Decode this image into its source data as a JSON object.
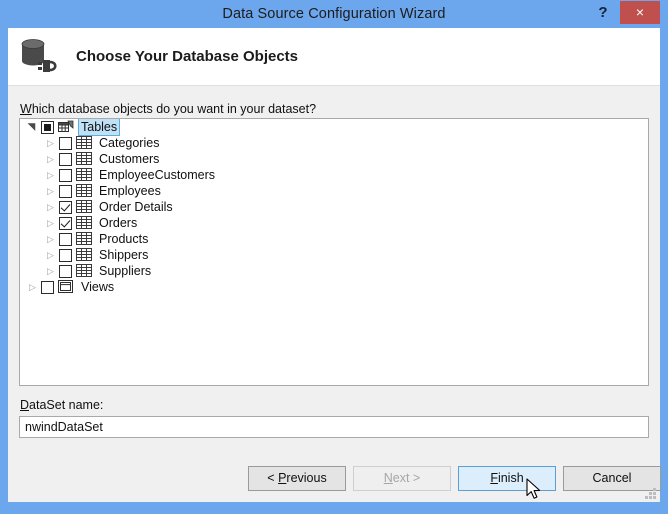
{
  "window": {
    "title": "Data Source Configuration Wizard",
    "help_label": "?",
    "close_label": "×"
  },
  "header": {
    "title": "Choose Your Database Objects",
    "icon": "database-connection-icon"
  },
  "body": {
    "prompt_accel": "W",
    "prompt_rest": "hich database objects do you want in your dataset?"
  },
  "tree": {
    "nodes": [
      {
        "label": "Tables",
        "level": 0,
        "expanded": true,
        "check_state": "indeterminate",
        "selected": true,
        "icon": "tables-group-icon",
        "name": "tree-node-tables"
      },
      {
        "label": "Categories",
        "level": 1,
        "expanded": false,
        "check_state": "unchecked",
        "selected": false,
        "icon": "table-icon",
        "name": "tree-node-categories"
      },
      {
        "label": "Customers",
        "level": 1,
        "expanded": false,
        "check_state": "unchecked",
        "selected": false,
        "icon": "table-icon",
        "name": "tree-node-customers"
      },
      {
        "label": "EmployeeCustomers",
        "level": 1,
        "expanded": false,
        "check_state": "unchecked",
        "selected": false,
        "icon": "table-icon",
        "name": "tree-node-employeecustomers"
      },
      {
        "label": "Employees",
        "level": 1,
        "expanded": false,
        "check_state": "unchecked",
        "selected": false,
        "icon": "table-icon",
        "name": "tree-node-employees"
      },
      {
        "label": "Order Details",
        "level": 1,
        "expanded": false,
        "check_state": "checked",
        "selected": false,
        "icon": "table-icon",
        "name": "tree-node-order-details"
      },
      {
        "label": "Orders",
        "level": 1,
        "expanded": false,
        "check_state": "checked",
        "selected": false,
        "icon": "table-icon",
        "name": "tree-node-orders"
      },
      {
        "label": "Products",
        "level": 1,
        "expanded": false,
        "check_state": "unchecked",
        "selected": false,
        "icon": "table-icon",
        "name": "tree-node-products"
      },
      {
        "label": "Shippers",
        "level": 1,
        "expanded": false,
        "check_state": "unchecked",
        "selected": false,
        "icon": "table-icon",
        "name": "tree-node-shippers"
      },
      {
        "label": "Suppliers",
        "level": 1,
        "expanded": false,
        "check_state": "unchecked",
        "selected": false,
        "icon": "table-icon",
        "name": "tree-node-suppliers"
      },
      {
        "label": "Views",
        "level": 0,
        "expanded": false,
        "check_state": "unchecked",
        "selected": false,
        "icon": "views-icon",
        "name": "tree-node-views"
      }
    ]
  },
  "dataset": {
    "label_accel": "D",
    "label_rest": "ataSet name:",
    "value": "nwindDataSet",
    "placeholder": ""
  },
  "buttons": {
    "previous": {
      "pre": "< ",
      "accel": "P",
      "post": "revious"
    },
    "next": {
      "pre": "",
      "accel": "N",
      "post": "ext >"
    },
    "finish": {
      "pre": "",
      "accel": "F",
      "post": "inish"
    },
    "cancel": {
      "pre": "",
      "accel": "",
      "post": "Cancel"
    }
  },
  "colors": {
    "titlebar": "#6ca6ec",
    "close_button": "#c0504d",
    "client_background": "#f0f0f0",
    "header_background": "#ffffff",
    "selection": "#bfe0f5",
    "hover_button": "#dcedfb"
  }
}
